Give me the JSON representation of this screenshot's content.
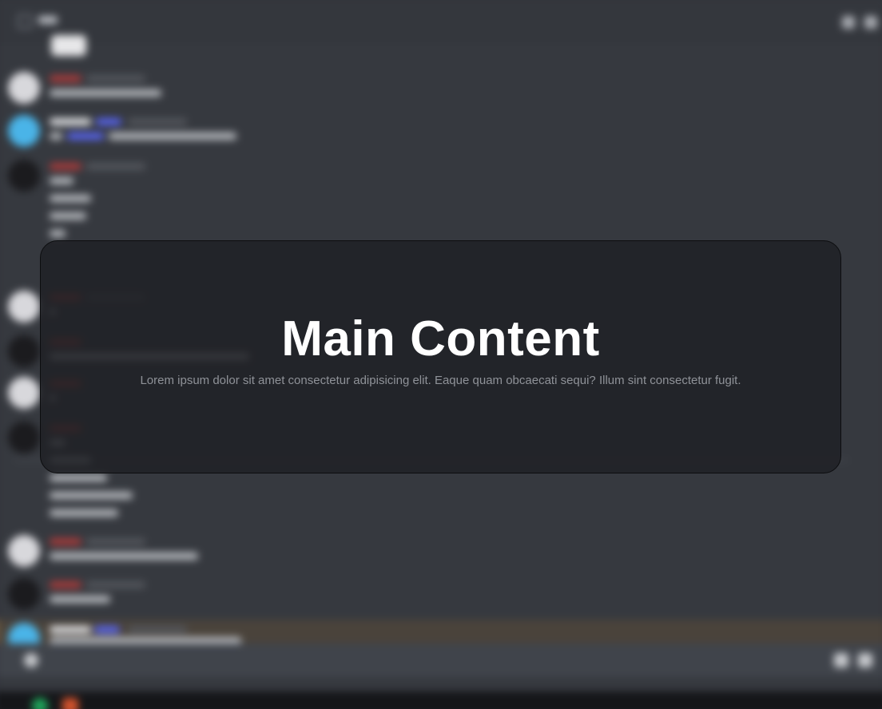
{
  "overlay": {
    "title": "Main Content",
    "subtitle": "Lorem ipsum dolor sit amet consectetur adipisicing elit. Eaque quam obcaecati sequi? Illum sint consectetur fugit."
  },
  "background": {
    "app_theme_colors": {
      "base": "#36393f",
      "composer": "#40444b",
      "accent": "#5865f2",
      "highlight": "#4a433b"
    },
    "icons": [
      "hashtag-icon",
      "bell-icon",
      "gift-icon",
      "plus-icon",
      "emoji-icon"
    ]
  }
}
